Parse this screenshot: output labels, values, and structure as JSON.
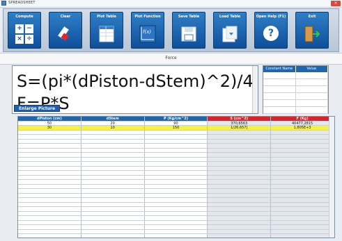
{
  "window": {
    "title": "SPREADSHEET",
    "close_label": "×"
  },
  "toolbar": {
    "buttons": [
      {
        "label": "Compute",
        "icon": "calculator-icon"
      },
      {
        "label": "Clear",
        "icon": "eraser-icon"
      },
      {
        "label": "Plot Table",
        "icon": "plot-table-icon"
      },
      {
        "label": "Plot Function",
        "icon": "plot-function-icon"
      },
      {
        "label": "Save Table",
        "icon": "save-table-icon"
      },
      {
        "label": "Load Table",
        "icon": "load-table-icon"
      },
      {
        "label": "Open Help (F1)",
        "icon": "help-icon"
      },
      {
        "label": "Exit",
        "icon": "exit-door-icon"
      }
    ],
    "fx_label": "f(x)",
    "help_glyph": "?"
  },
  "section": {
    "title": "Force"
  },
  "formula": {
    "line1": "S=(pi*(dPiston-dStem)^2)/4",
    "line2": "F=P*S"
  },
  "enlarge_button": "Enlarge Picture",
  "constants_table": {
    "headers": [
      "Constant Name",
      "Value"
    ],
    "rows": 6
  },
  "grid": {
    "headers": [
      "dPiston (cm)",
      "dStem",
      "P (Kg/cm^2)",
      "S (cm^2)",
      "F (Kg)"
    ],
    "rows": [
      [
        "50",
        "20",
        "90",
        "370,6563",
        "40477,2815"
      ],
      [
        "30",
        "10",
        "150",
        "1/26,657]",
        "1,805E+3"
      ]
    ],
    "empty_rows": 24
  },
  "colors": {
    "accent": "#1e66ad",
    "header_red": "#d8252b",
    "highlight_yellow": "#f7f23c"
  }
}
